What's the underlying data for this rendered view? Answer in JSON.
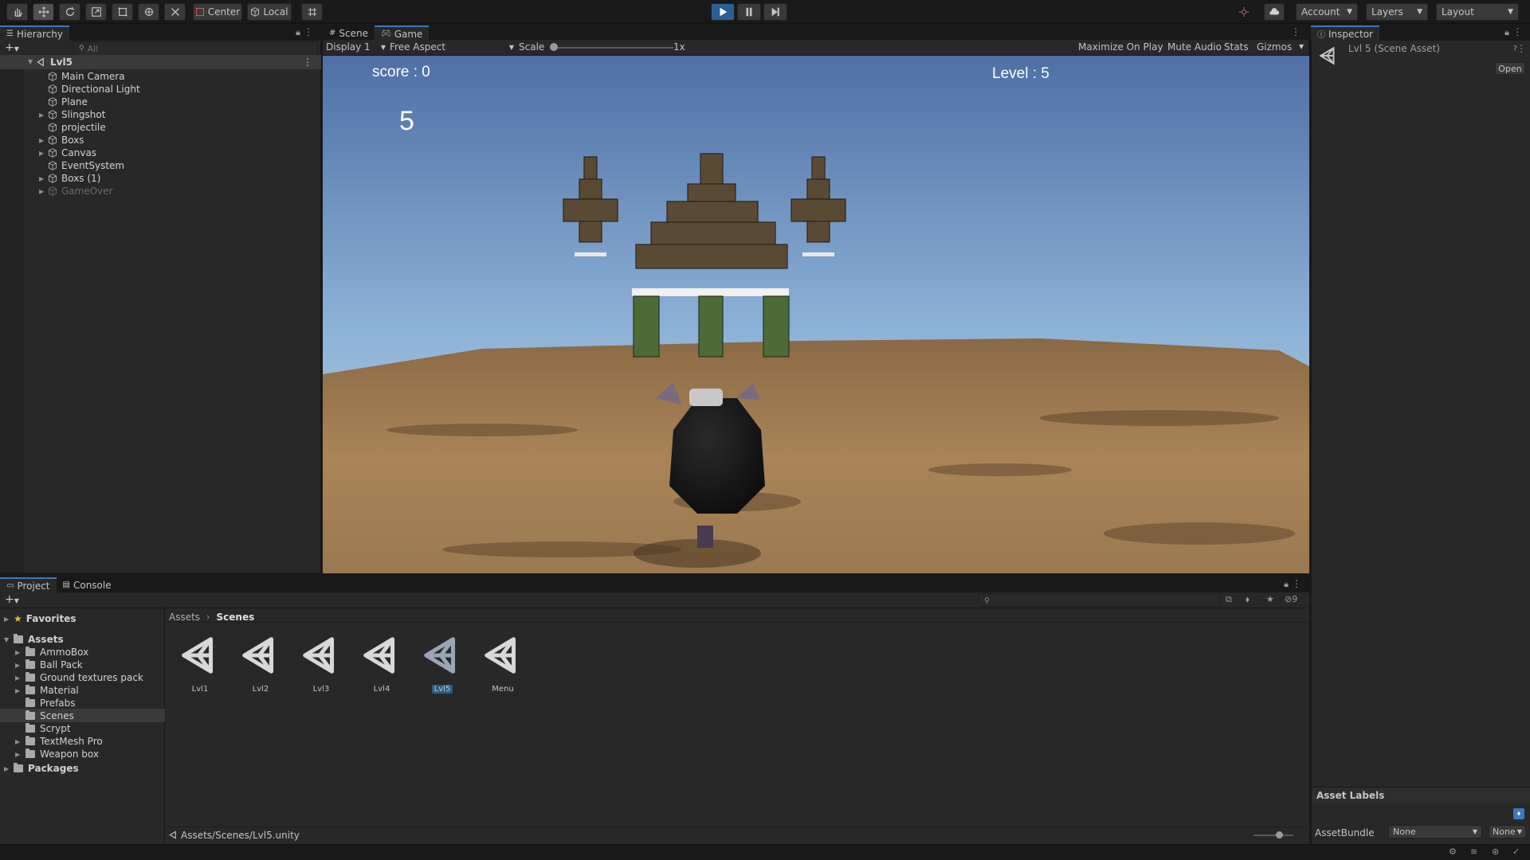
{
  "toolbar": {
    "tools": [
      "hand-tool-icon",
      "move-tool-icon",
      "rotate-tool-icon",
      "scale-tool-icon",
      "rect-tool-icon",
      "transform-tool-icon",
      "custom-tool-icon"
    ],
    "pivot_label": "Center",
    "space_label": "Local",
    "account_label": "Account",
    "layers_label": "Layers",
    "layout_label": "Layout"
  },
  "hierarchy": {
    "tab": "Hierarchy",
    "search_placeholder": "All",
    "scene": "Lvl5",
    "items": [
      {
        "label": "Main Camera",
        "expandable": false
      },
      {
        "label": "Directional Light",
        "expandable": false
      },
      {
        "label": "Plane",
        "expandable": false
      },
      {
        "label": "Slingshot",
        "expandable": true
      },
      {
        "label": "projectile",
        "expandable": false
      },
      {
        "label": "Boxs",
        "expandable": true
      },
      {
        "label": "Canvas",
        "expandable": true
      },
      {
        "label": "EventSystem",
        "expandable": false
      },
      {
        "label": "Boxs (1)",
        "expandable": true
      },
      {
        "label": "GameOver",
        "expandable": true,
        "disabled": true
      }
    ]
  },
  "center_tabs": {
    "scene": "Scene",
    "game": "Game"
  },
  "game_toolbar": {
    "display": "Display 1",
    "aspect": "Free Aspect",
    "scale_label": "Scale",
    "scale_value": "1x",
    "maximize": "Maximize On Play",
    "mute": "Mute Audio",
    "stats": "Stats",
    "gizmos": "Gizmos"
  },
  "game_view": {
    "score": "score : 0",
    "level": "Level : 5",
    "counter": "5"
  },
  "inspector": {
    "tab": "Inspector",
    "title": "Lvl 5 (Scene Asset)",
    "open": "Open",
    "asset_labels": "Asset Labels",
    "assetbundle_label": "AssetBundle",
    "assetbundle_value": "None",
    "variant_value": "None"
  },
  "bottom_tabs": {
    "project": "Project",
    "console": "Console"
  },
  "project": {
    "favorites": "Favorites",
    "assets": "Assets",
    "folders": [
      "AmmoBox",
      "Ball Pack",
      "Ground textures pack",
      "Material",
      "Prefabs",
      "Scenes",
      "Scrypt",
      "TextMesh Pro",
      "Weapon box"
    ],
    "packages": "Packages",
    "breadcrumb": [
      "Assets",
      "Scenes"
    ],
    "files": [
      "Lvl1",
      "Lvl2",
      "Lvl3",
      "Lvl4",
      "Lvl5",
      "Menu"
    ],
    "selected_file": "Lvl5",
    "path": "Assets/Scenes/Lvl5.unity",
    "hidden_count": "9"
  },
  "colors": {
    "accent": "#3a79bb",
    "panel": "#282828",
    "background": "#191919",
    "play_active": "#2b5f93"
  }
}
